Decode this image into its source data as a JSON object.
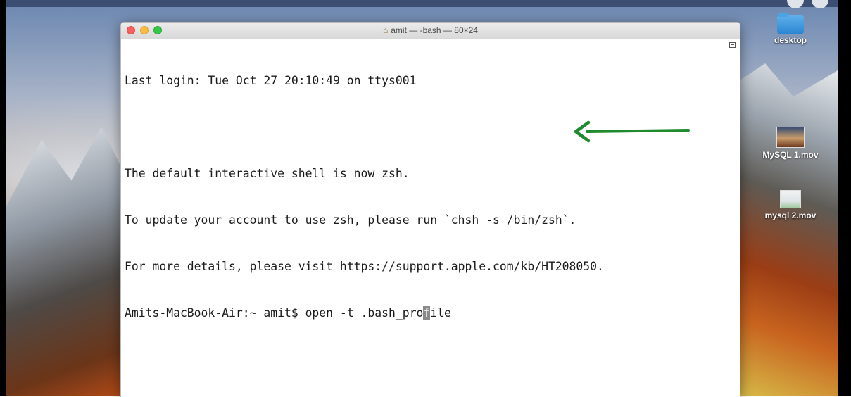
{
  "terminal": {
    "title": "amit — -bash — 80×24",
    "lines": [
      "Last login: Tue Oct 27 20:10:49 on ttys001",
      "",
      "The default interactive shell is now zsh.",
      "To update your account to use zsh, please run `chsh -s /bin/zsh`.",
      "For more details, please visit https://support.apple.com/kb/HT208050."
    ],
    "prompt_before_cursor": "Amits-MacBook-Air:~ amit$ open -t .bash_pro",
    "cursor_char": "f",
    "prompt_after_cursor": "ile"
  },
  "desktop": {
    "icons": [
      {
        "label": "desktop",
        "icon": "folder-icon"
      },
      {
        "label": "MySQL 1.mov",
        "icon": "video-file-icon"
      },
      {
        "label": "mysql 2.mov",
        "icon": "video-file-icon"
      }
    ]
  },
  "annotation": {
    "arrow_color": "#1f8a2e"
  }
}
